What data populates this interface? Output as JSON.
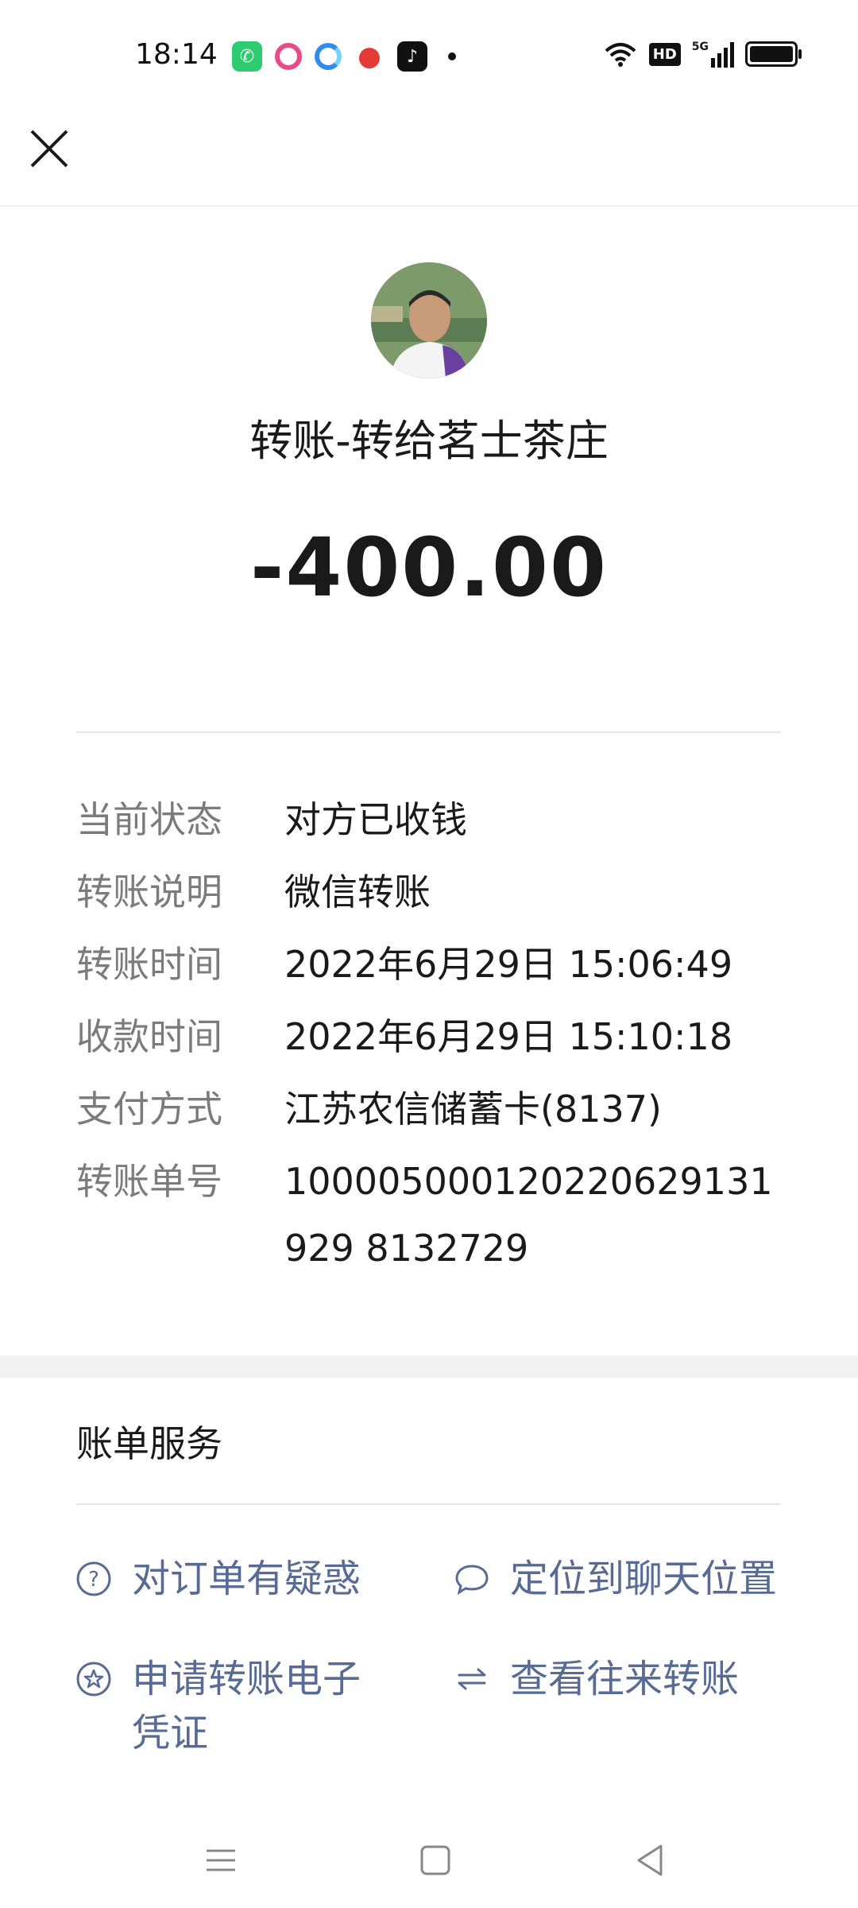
{
  "status_bar": {
    "time": "18:14",
    "app_icons": [
      "phone-app-icon",
      "ring-app-icon",
      "browser-app-icon",
      "map-pin-app-icon",
      "tiktok-app-icon"
    ],
    "indicators": [
      "wifi-icon",
      "hd-badge",
      "5g-signal-icon",
      "battery-icon"
    ],
    "hd_label": "HD",
    "network_label": "5G"
  },
  "header": {
    "close_icon": "close-icon"
  },
  "transfer": {
    "title": "转账-转给茗士茶庄",
    "amount": "-400.00"
  },
  "details": [
    {
      "label": "当前状态",
      "value": "对方已收钱"
    },
    {
      "label": "转账说明",
      "value": "微信转账"
    },
    {
      "label": "转账时间",
      "value": "2022年6月29日 15:06:49"
    },
    {
      "label": "收款时间",
      "value": "2022年6月29日 15:10:18"
    },
    {
      "label": "支付方式",
      "value": "江苏农信储蓄卡(8137)"
    },
    {
      "label": "转账单号",
      "value": "100005000120220629131929 8132729"
    }
  ],
  "bill_services": {
    "title": "账单服务",
    "items": [
      {
        "label": "对订单有疑惑",
        "icon": "question-icon"
      },
      {
        "label": "定位到聊天位置",
        "icon": "chat-bubble-icon"
      },
      {
        "label": "申请转账电子凭证",
        "icon": "star-badge-icon"
      },
      {
        "label": "查看往来转账",
        "icon": "swap-arrows-icon"
      }
    ]
  },
  "colors": {
    "link": "#576b95",
    "label_gray": "#7b7b7b",
    "text": "#1a1a1a",
    "divider": "#e6e6e6"
  },
  "nav_bar": {
    "buttons": [
      "menu-icon",
      "home-icon",
      "back-icon"
    ]
  }
}
